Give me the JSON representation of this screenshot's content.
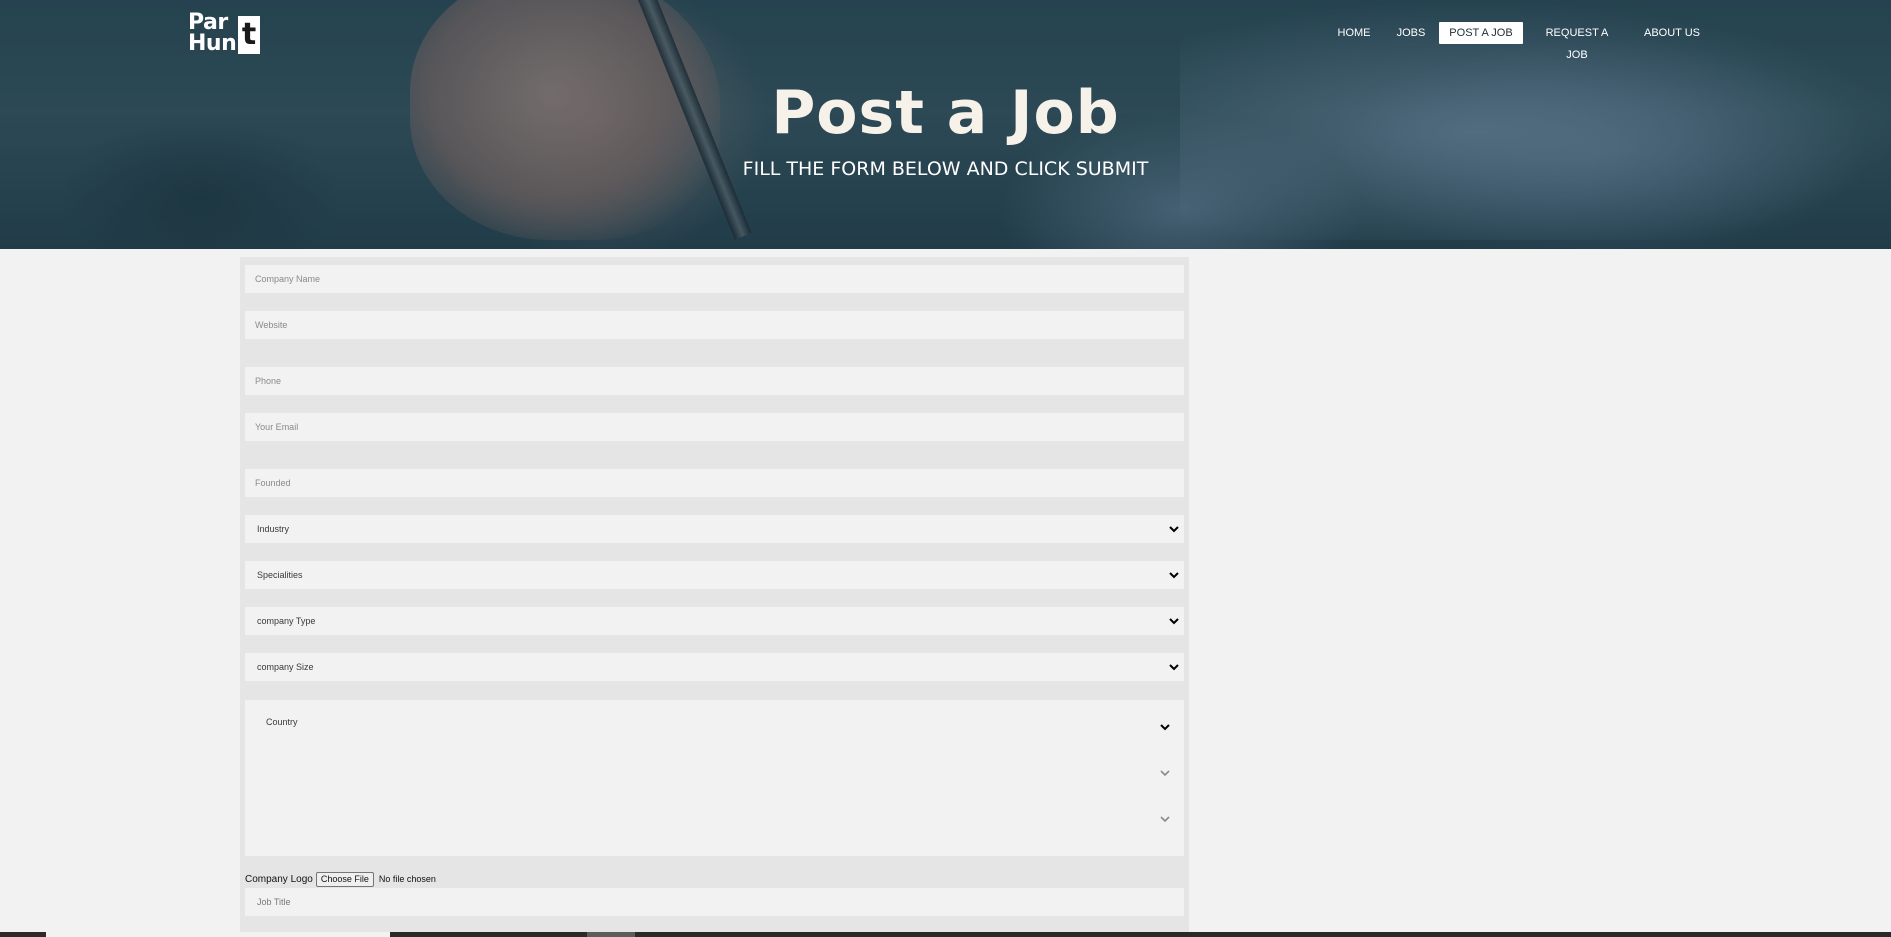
{
  "brand": {
    "line1": "Par",
    "line2": "Hun",
    "t": "t"
  },
  "nav": {
    "items": [
      {
        "label": "HOME",
        "active": false
      },
      {
        "label": "JOBS",
        "active": false
      },
      {
        "label": "POST A JOB",
        "active": true
      },
      {
        "label": "REQUEST A JOB",
        "active": false
      },
      {
        "label": "ABOUT US",
        "active": false
      }
    ]
  },
  "hero": {
    "title": "Post a Job",
    "subtitle": "FILL THE FORM BELOW AND CLICK SUBMIT"
  },
  "form": {
    "company_name_placeholder": "Company Name",
    "website_placeholder": "Website",
    "phone_placeholder": "Phone",
    "email_placeholder": "Your Email",
    "founded_placeholder": "Founded",
    "industry_label": "Industry",
    "specialities_label": "Specialities",
    "company_type_label": "company Type",
    "company_size_label": "company Size",
    "country_label": "Country",
    "company_logo_label": "Company Logo",
    "choose_file_label": "Choose File",
    "file_status": "No file chosen",
    "job_title_placeholder": "Job Title"
  },
  "colors": {
    "page_bg": "#f2f2f2",
    "panel_bg": "#e5e5e5",
    "field_bg": "#f2f2f2",
    "hero_title": "#f6f2ea"
  }
}
